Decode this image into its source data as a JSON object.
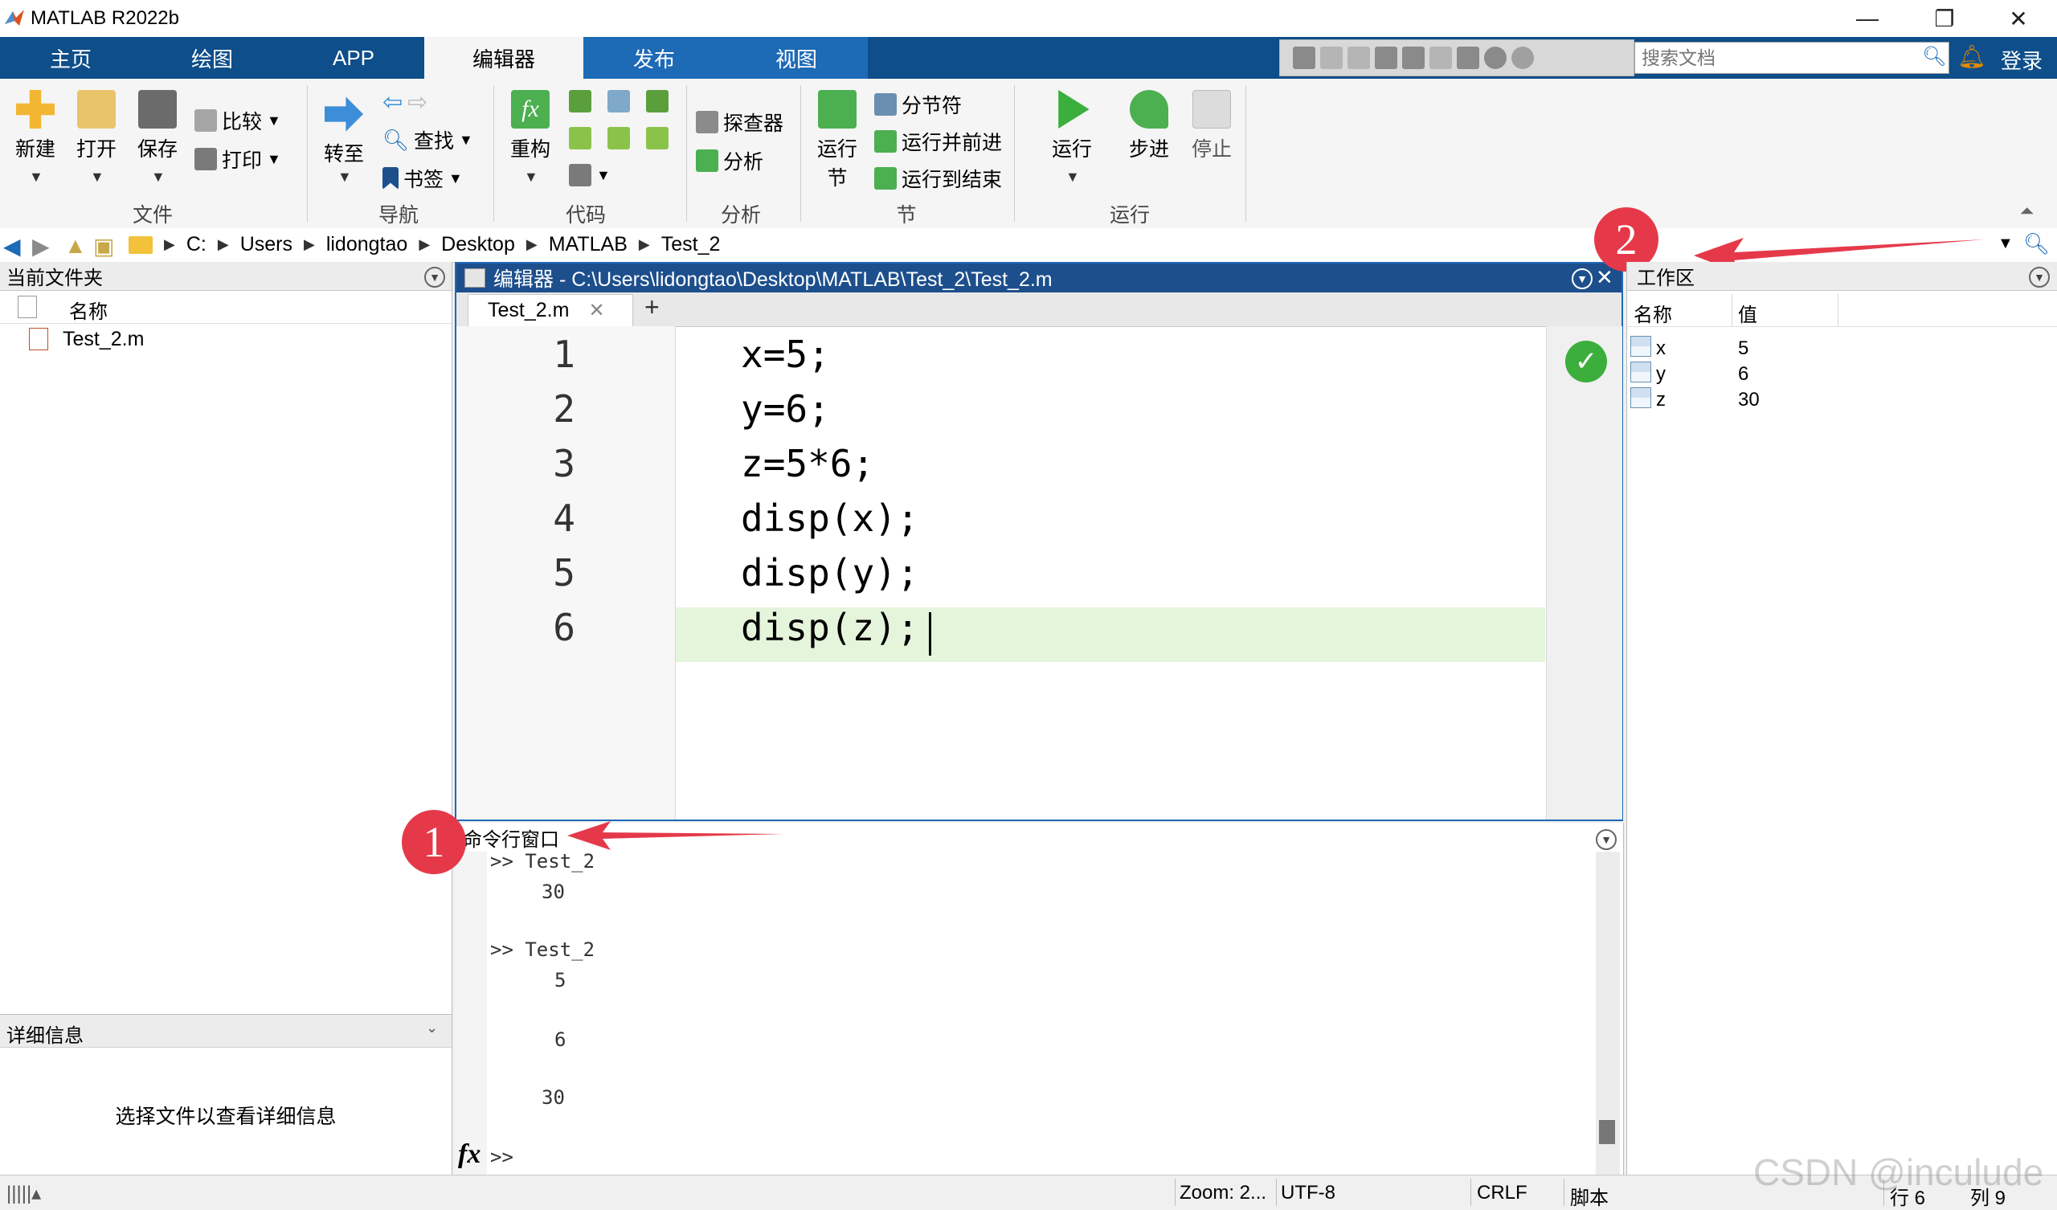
{
  "window": {
    "title": "MATLAB R2022b"
  },
  "tabs": [
    "主页",
    "绘图",
    "APP",
    "编辑器",
    "发布",
    "视图"
  ],
  "search": {
    "placeholder": "搜索文档"
  },
  "login": "登录",
  "ribbon": {
    "file": {
      "new": "新建",
      "open": "打开",
      "save": "保存",
      "compare": "比较",
      "print": "打印",
      "group": "文件"
    },
    "navigate": {
      "goto": "转至",
      "find": "查找",
      "bookmark": "书签",
      "group": "导航"
    },
    "code": {
      "refactor": "重构",
      "group": "代码"
    },
    "analyze": {
      "profiler": "探查器",
      "analyze": "分析",
      "group": "分析"
    },
    "section": {
      "run_section_1": "运行",
      "run_section_2": "节",
      "section_break": "分节符",
      "run_advance": "运行并前进",
      "run_to_end": "运行到结束",
      "group": "节"
    },
    "run": {
      "run": "运行",
      "step": "步进",
      "stop": "停止",
      "group": "运行"
    }
  },
  "address": {
    "crumbs": [
      "C:",
      "Users",
      "lidongtao",
      "Desktop",
      "MATLAB",
      "Test_2"
    ]
  },
  "current_folder": {
    "title": "当前文件夹",
    "column": "名称",
    "files": [
      "Test_2.m"
    ]
  },
  "details": {
    "title": "详细信息",
    "message": "选择文件以查看详细信息"
  },
  "editor": {
    "title": "编辑器 - C:\\Users\\lidongtao\\Desktop\\MATLAB\\Test_2\\Test_2.m",
    "tab": "Test_2.m",
    "line_numbers": [
      "1",
      "2",
      "3",
      "4",
      "5",
      "6"
    ],
    "lines": [
      "x=5;",
      "y=6;",
      "z=5*6;",
      "disp(x);",
      "disp(y);",
      "disp(z);"
    ]
  },
  "command_window": {
    "title": "命令行窗口",
    "output": [
      ">> Test_2",
      "30",
      ">> Test_2",
      "5",
      "6",
      "30"
    ],
    "prompt": ">>",
    "fx": "fx"
  },
  "workspace": {
    "title": "工作区",
    "columns": [
      "名称",
      "值"
    ],
    "variables": [
      {
        "name": "x",
        "value": "5"
      },
      {
        "name": "y",
        "value": "6"
      },
      {
        "name": "z",
        "value": "30"
      }
    ]
  },
  "annotations": {
    "badge1": "1",
    "badge2": "2",
    "arrow_color": "#e53949"
  },
  "status": {
    "zoom": "Zoom: 2...",
    "encoding": "UTF-8",
    "eol": "CRLF",
    "type": "脚本",
    "row": "行 6",
    "col": "列 9"
  },
  "watermark": "CSDN @inculude",
  "colors": {
    "tabstrip": "#0e4e8a",
    "active_tab": "#f5f5f5",
    "editor_title": "#1d4f8c",
    "current_line": "#e4f5dc",
    "ok": "#3cae3c"
  },
  "icons": [
    "matlab-logo-icon",
    "minimize-icon",
    "restore-icon",
    "close-icon",
    "search-icon",
    "bell-icon",
    "back-icon",
    "forward-icon",
    "folder-icon",
    "check-icon",
    "file-icon",
    "variable-icon",
    "fx-icon"
  ]
}
